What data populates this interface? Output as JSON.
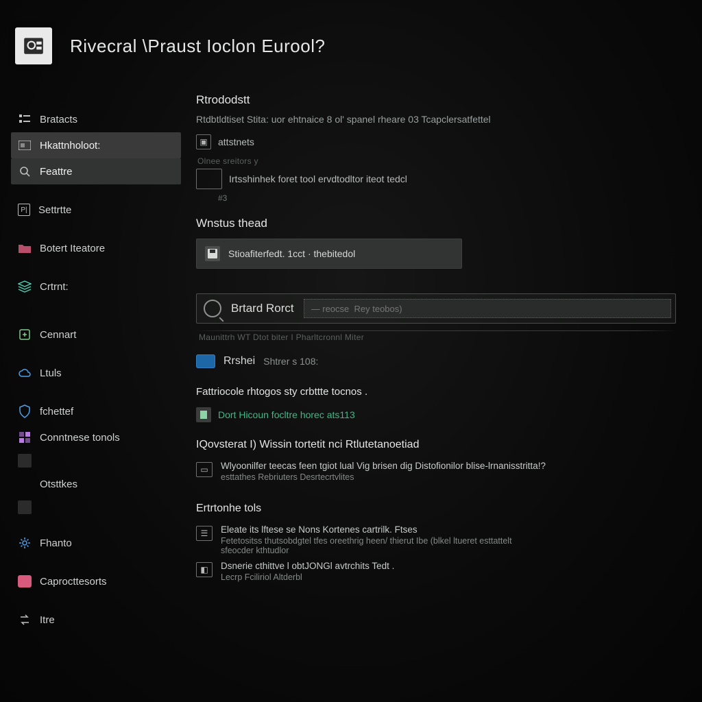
{
  "header": {
    "title": "Rivecral \\Praust Ioclon Eurool?"
  },
  "sidebar": {
    "items": [
      {
        "label": "Bratacts"
      },
      {
        "label": "Hkattnholoot:"
      },
      {
        "label": "Feattre"
      },
      {
        "label": "Settrtte"
      },
      {
        "label": "Botert Iteatore"
      },
      {
        "label": "Crtrnt:"
      },
      {
        "label": "Cennart"
      },
      {
        "label": "Ltuls"
      },
      {
        "label": "fchettef"
      },
      {
        "label": "Conntnese tonols"
      },
      {
        "label": "Otsttkes"
      },
      {
        "label": "Fhanto"
      },
      {
        "label": "Caprocttesorts"
      },
      {
        "label": "Itre"
      }
    ],
    "muted": ""
  },
  "main": {
    "s1": {
      "title": "Rtrododstt",
      "desc": "Rtdbtldtiset Stita:  uor ehtnaice 8 ol' spanel  rheare 03 Tcapclersatfettel",
      "row1": "attstnets",
      "row2_label": "Olnee sreitors y",
      "row2_text": "Irtsshinhek foret  tool ervdtodltor iteot tedcl",
      "row2_caption": "#3"
    },
    "s2": {
      "title": "Wnstus thead",
      "card": "Stioafiterfedt. 1cct · thebitedol"
    },
    "search": {
      "label": "Brtard Rorct",
      "placeholder": "— reocse  Rey teobos)",
      "underline": "Maunittrh WT   Dtot biter I  Pharltcronnl Miter"
    },
    "badge": {
      "text1": "Rrshei",
      "text2": "Shtrer s 108:"
    },
    "s3": {
      "title": "Fattriocole rhtogos sty crbttte tocnos .",
      "row1": "Dort Hicoun  focltre  horec ats113",
      "sub_title": "IQovsterat I) Wissin  tortetit nci Rtlutetanoetiad",
      "sub_row1": "Wlyoonilfer teecas feen tgiot  lual Vig brisen dig Distofionilor  blise-lrnanisstritta!?",
      "sub_row2": "esttathes Rebriuters Desrtecrtvlites"
    },
    "s4": {
      "title": "Ertrtonhe tols",
      "i1": {
        "l1": "Eleate its  lftese se Nons Kortenes cartrilk. Ftses",
        "l2": "Fetetositss  thutsobdgtel tfes oreethrig  heen/ thierut  Ibe  (blkel ltueret esttattelt\nsfeocder kthtudlor"
      },
      "i2": {
        "l1": "Dsnerie cthittve l obtJONGl  avtrchits Tedt .",
        "l2": "Lecrp Fciliriol Altderbl"
      }
    }
  }
}
